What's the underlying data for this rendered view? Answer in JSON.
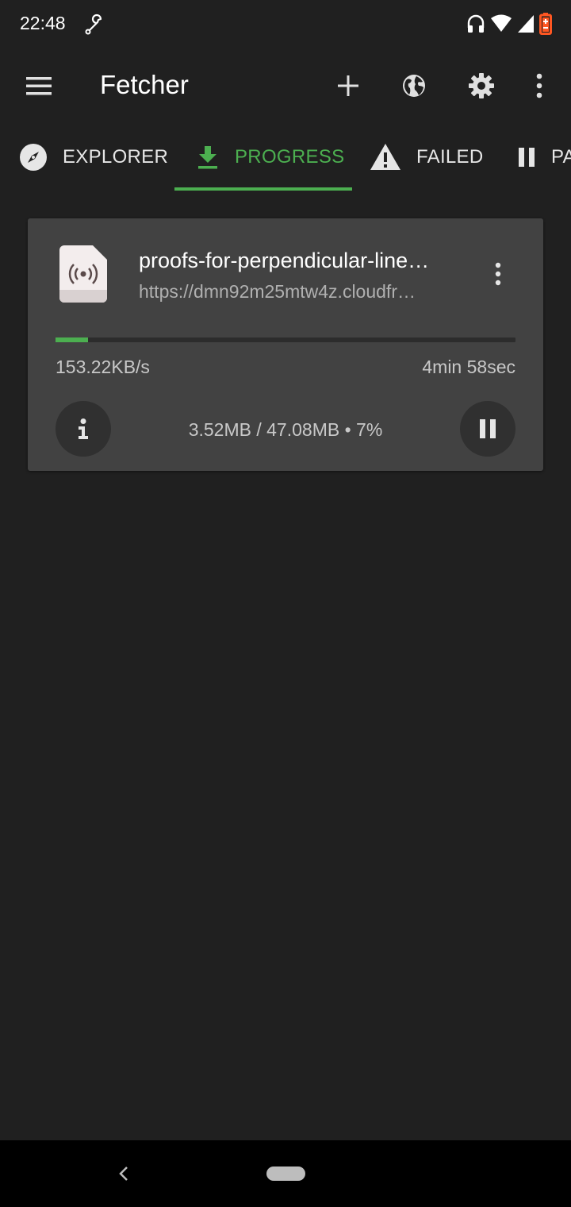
{
  "status_bar": {
    "time": "22:48",
    "icons": [
      "wrench-icon",
      "headphones-icon",
      "wifi-icon",
      "signal-icon",
      "battery-icon"
    ],
    "battery_color": "#ff5722"
  },
  "app_bar": {
    "title": "Fetcher",
    "icons": [
      "menu-icon",
      "add-icon",
      "globe-icon",
      "settings-icon",
      "more-vert-icon"
    ]
  },
  "tabs": [
    {
      "label": "EXPLORER",
      "icon": "compass-icon",
      "active": false
    },
    {
      "label": "PROGRESS",
      "icon": "download-icon",
      "active": true
    },
    {
      "label": "FAILED",
      "icon": "warning-icon",
      "active": false
    },
    {
      "label": "PA",
      "icon": "pause-icon",
      "active": false
    }
  ],
  "download": {
    "file_name": "proofs-for-perpendicular-line…",
    "url": "https://dmn92m25mtw4z.cloudfr…",
    "progress_fraction": 0.07,
    "speed": "153.22KB/s",
    "eta": "4min 58sec",
    "size_info": "3.52MB / 47.08MB • 7%",
    "icons": [
      "broadcast-file-icon",
      "more-vert-icon",
      "info-icon",
      "pause-icon"
    ]
  },
  "colors": {
    "accent": "#4caf50",
    "background": "#202020",
    "card": "#424242"
  }
}
